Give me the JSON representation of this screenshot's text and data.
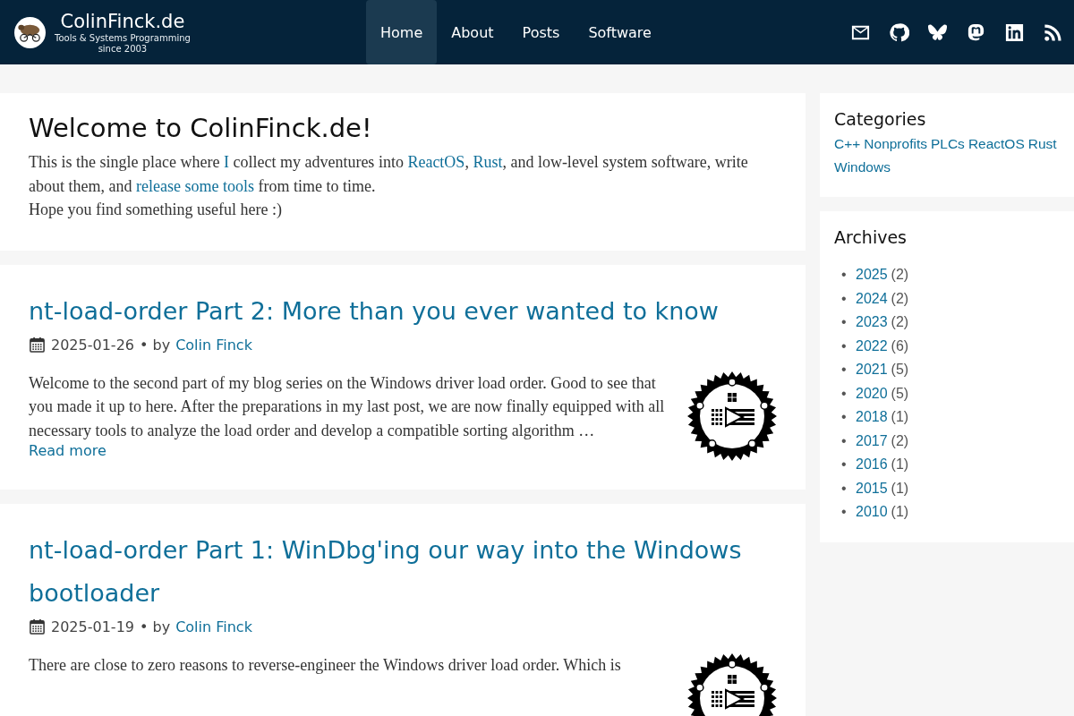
{
  "site": {
    "title": "ColinFinck.de",
    "tagline": "Tools & Systems Programming",
    "tagline_2": "since 2003"
  },
  "nav": [
    {
      "label": "Home",
      "selected": true
    },
    {
      "label": "About",
      "selected": false
    },
    {
      "label": "Posts",
      "selected": false
    },
    {
      "label": "Software",
      "selected": false
    }
  ],
  "social": [
    {
      "kind": "mail"
    },
    {
      "kind": "github"
    },
    {
      "kind": "butterfly"
    },
    {
      "kind": "mastodon"
    },
    {
      "kind": "linkedin"
    },
    {
      "kind": "rss"
    }
  ],
  "welcome": {
    "title": "Welcome to ColinFinck.de!",
    "intro": [
      {
        "text": "This is the single place where ",
        "link": false
      },
      {
        "text": "I",
        "link": true
      },
      {
        "text": " collect my adventures into ",
        "link": false
      },
      {
        "text": "ReactOS",
        "link": true
      },
      {
        "text": ", ",
        "link": false
      },
      {
        "text": "Rust",
        "link": true
      },
      {
        "text": ", and low-level system software, write about them, and ",
        "link": false
      },
      {
        "text": "release some tools",
        "link": true
      },
      {
        "text": " from time to time.",
        "link": false
      }
    ],
    "closing": "Hope you find something useful here :)"
  },
  "posts": [
    {
      "title": "nt-load-order Part 2: More than you ever wanted to know",
      "date": "2025-01-26",
      "by": "• by",
      "author": "Colin Finck",
      "excerpt": "Welcome to the second part of my blog series on the Windows driver load order. Good to see that you made it up to here. After the preparations in my last post, we are now finally equipped with all necessary tools to analyze the load order and develop a compatible sorting algorithm …",
      "read_more": "Read more"
    },
    {
      "title": "nt-load-order Part 1: WinDbg'ing our way into the Windows bootloader",
      "date": "2025-01-19",
      "by": "• by",
      "author": "Colin Finck",
      "excerpt": "There are close to zero reasons to reverse-engineer the Windows driver load order. Which is"
    }
  ],
  "categories": {
    "title": "Categories",
    "items": [
      "C++",
      "Nonprofits",
      "PLCs",
      "ReactOS",
      "Rust",
      "Windows"
    ]
  },
  "archives": {
    "title": "Archives",
    "items": [
      {
        "bullet": "•",
        "year": "2025",
        "count": "(2)"
      },
      {
        "bullet": "•",
        "year": "2024",
        "count": "(2)"
      },
      {
        "bullet": "•",
        "year": "2023",
        "count": "(2)"
      },
      {
        "bullet": "•",
        "year": "2022",
        "count": "(6)"
      },
      {
        "bullet": "•",
        "year": "2021",
        "count": "(5)"
      },
      {
        "bullet": "•",
        "year": "2020",
        "count": "(5)"
      },
      {
        "bullet": "•",
        "year": "2018",
        "count": "(1)"
      },
      {
        "bullet": "•",
        "year": "2017",
        "count": "(2)"
      },
      {
        "bullet": "•",
        "year": "2016",
        "count": "(1)"
      },
      {
        "bullet": "•",
        "year": "2015",
        "count": "(1)"
      },
      {
        "bullet": "•",
        "year": "2010",
        "count": "(1)"
      }
    ]
  }
}
